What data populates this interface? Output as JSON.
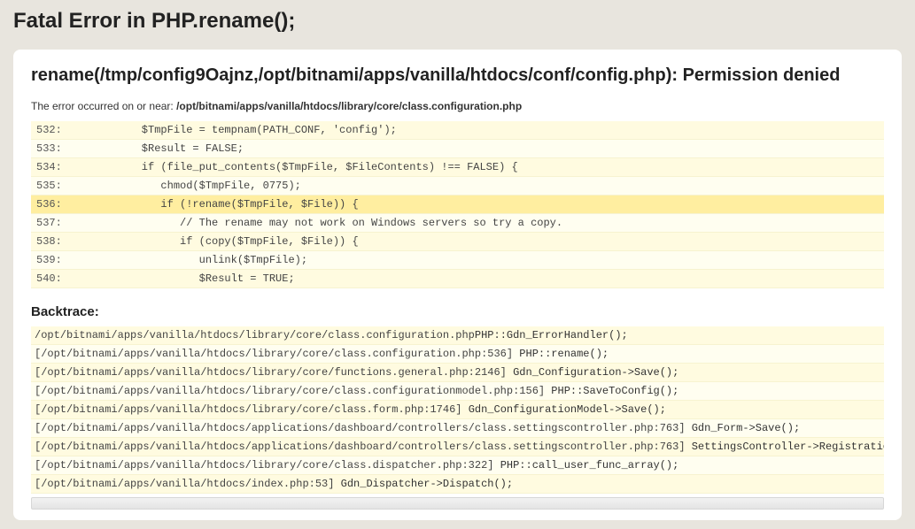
{
  "page_title": "Fatal Error in PHP.rename();",
  "error_title": "rename(/tmp/config9Oajnz,/opt/bitnami/apps/vanilla/htdocs/conf/config.php): Permission denied",
  "error_location_label": "The error occurred on or near: ",
  "error_location_path": "/opt/bitnami/apps/vanilla/htdocs/library/core/class.configuration.php",
  "code_lines": [
    {
      "n": "532:",
      "t": "         $TmpFile = tempnam(PATH_CONF, 'config');",
      "hl": false
    },
    {
      "n": "533:",
      "t": "         $Result = FALSE;",
      "hl": false
    },
    {
      "n": "534:",
      "t": "         if (file_put_contents($TmpFile, $FileContents) !== FALSE) {",
      "hl": false
    },
    {
      "n": "535:",
      "t": "            chmod($TmpFile, 0775);",
      "hl": false
    },
    {
      "n": "536:",
      "t": "            if (!rename($TmpFile, $File)) {",
      "hl": true
    },
    {
      "n": "537:",
      "t": "               // The rename may not work on Windows servers so try a copy.",
      "hl": false
    },
    {
      "n": "538:",
      "t": "               if (copy($TmpFile, $File)) {",
      "hl": false
    },
    {
      "n": "539:",
      "t": "                  unlink($TmpFile);",
      "hl": false
    },
    {
      "n": "540:",
      "t": "                  $Result = TRUE;",
      "hl": false
    }
  ],
  "backtrace_heading": "Backtrace:",
  "backtrace": [
    {
      "path": "/opt/bitnami/apps/vanilla/htdocs/library/core/class.configuration.php",
      "call": "PHP::Gdn_ErrorHandler();"
    },
    {
      "path": "[/opt/bitnami/apps/vanilla/htdocs/library/core/class.configuration.php:536] ",
      "call": "PHP::rename();"
    },
    {
      "path": "[/opt/bitnami/apps/vanilla/htdocs/library/core/functions.general.php:2146] ",
      "call": "Gdn_Configuration->Save();"
    },
    {
      "path": "[/opt/bitnami/apps/vanilla/htdocs/library/core/class.configurationmodel.php:156] ",
      "call": "PHP::SaveToConfig();"
    },
    {
      "path": "[/opt/bitnami/apps/vanilla/htdocs/library/core/class.form.php:1746] ",
      "call": "Gdn_ConfigurationModel->Save();"
    },
    {
      "path": "[/opt/bitnami/apps/vanilla/htdocs/applications/dashboard/controllers/class.settingscontroller.php:763] ",
      "call": "Gdn_Form->Save();"
    },
    {
      "path": "[/opt/bitnami/apps/vanilla/htdocs/applications/dashboard/controllers/class.settingscontroller.php:763] ",
      "call": "SettingsController->Registratio"
    },
    {
      "path": "[/opt/bitnami/apps/vanilla/htdocs/library/core/class.dispatcher.php:322] ",
      "call": "PHP::call_user_func_array();"
    },
    {
      "path": "[/opt/bitnami/apps/vanilla/htdocs/index.php:53] ",
      "call": "Gdn_Dispatcher->Dispatch();"
    }
  ]
}
